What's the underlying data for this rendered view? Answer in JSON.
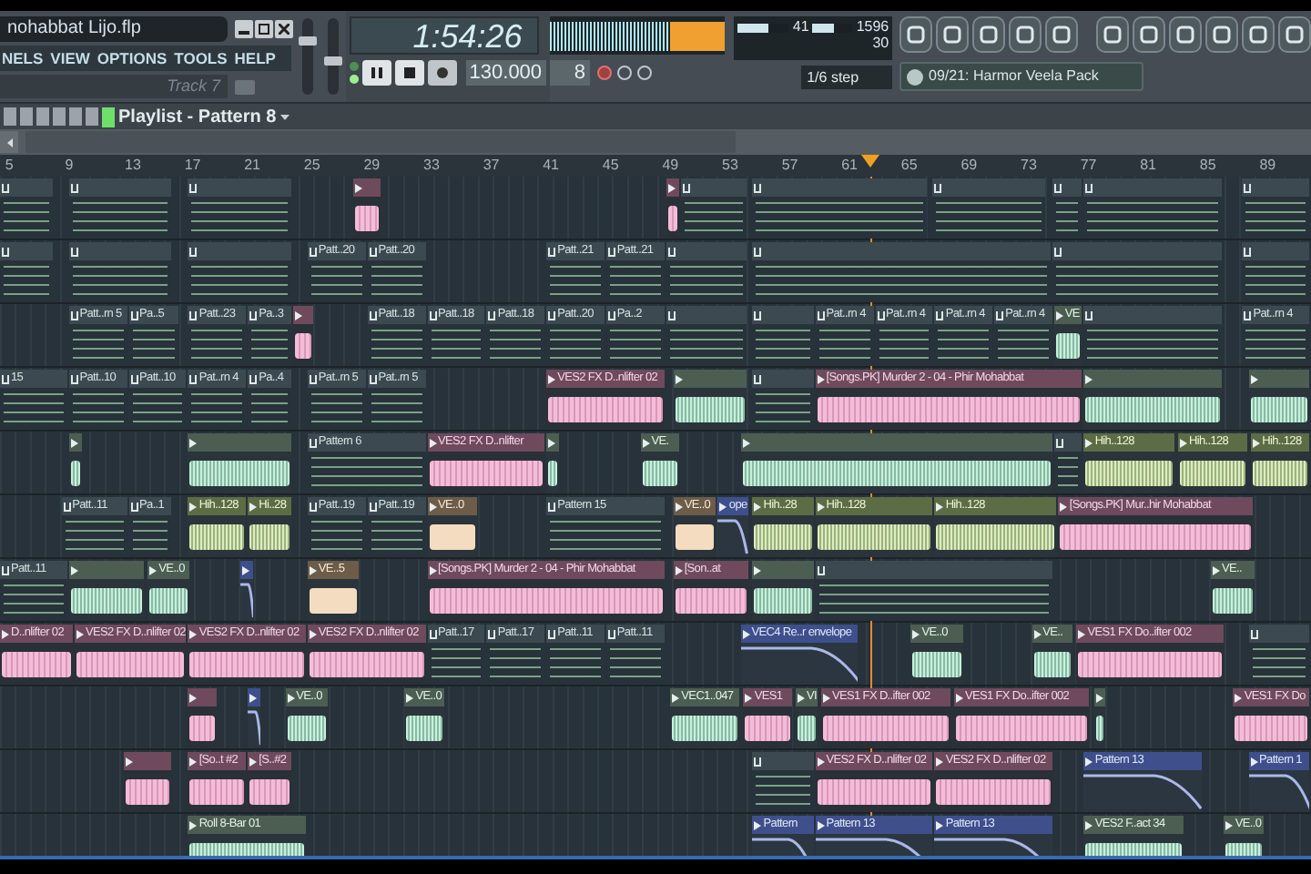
{
  "project": {
    "title": "nohabbat Lijo.flp"
  },
  "menu": [
    "NELS",
    "VIEW",
    "OPTIONS",
    "TOOLS",
    "HELP"
  ],
  "hint": "Track 7",
  "volume": {
    "level": 0.75
  },
  "pitch": {
    "level": 0.45
  },
  "time": "1:54:26",
  "tempo": "130.000",
  "pattern": "8",
  "cpu": {
    "value": "41",
    "level": 0.6
  },
  "memory": {
    "value": "1596",
    "level": 0.55
  },
  "polyphony": "30",
  "snap": "1/6 step",
  "browser": "09/21: Harmor Veela Pack",
  "playlist": {
    "title": "Playlist - Pattern 8"
  },
  "ruler": [
    "5",
    "9",
    "13",
    "17",
    "21",
    "25",
    "29",
    "33",
    "37",
    "41",
    "45",
    "49",
    "53",
    "57",
    "61",
    "65",
    "69",
    "73",
    "77",
    "81",
    "85",
    "89"
  ],
  "tracks": [
    {
      "clips": [
        {
          "kind": "pattern"
        },
        {
          "kind": "pattern"
        },
        {
          "kind": "pattern"
        },
        {
          "kind": "pink"
        },
        {
          "kind": "pink"
        },
        {
          "kind": "pattern"
        },
        {
          "kind": "pattern"
        },
        {
          "kind": "pattern"
        },
        {
          "kind": "pattern"
        },
        {
          "kind": "pattern"
        },
        {
          "kind": "pattern"
        }
      ]
    },
    {
      "clips": [
        {
          "kind": "pattern"
        },
        {
          "kind": "pattern"
        },
        {
          "kind": "pattern"
        },
        {
          "kind": "pattern",
          "label": "Patt..20"
        },
        {
          "kind": "pattern",
          "label": "Patt..20"
        },
        {
          "kind": "pattern",
          "label": "Patt..21"
        },
        {
          "kind": "pattern",
          "label": "Patt..21"
        },
        {
          "kind": "pattern"
        },
        {
          "kind": "pattern"
        },
        {
          "kind": "pattern"
        },
        {
          "kind": "pattern"
        }
      ]
    },
    {
      "clips": [
        {
          "kind": "pattern",
          "label": "Patt..rn 5"
        },
        {
          "kind": "pattern",
          "label": "Pa..5"
        },
        {
          "kind": "pattern",
          "label": "Patt..23"
        },
        {
          "kind": "pattern",
          "label": "Pa..3"
        },
        {
          "kind": "pink"
        },
        {
          "kind": "pattern",
          "label": "Patt..18"
        },
        {
          "kind": "pattern",
          "label": "Patt..18"
        },
        {
          "kind": "pattern",
          "label": "Patt..18"
        },
        {
          "kind": "pattern",
          "label": "Patt..20"
        },
        {
          "kind": "pattern",
          "label": "Pa..2"
        },
        {
          "kind": "pattern"
        },
        {
          "kind": "pattern"
        },
        {
          "kind": "pattern",
          "label": "Pat..rn 4"
        },
        {
          "kind": "pattern",
          "label": "Pat..rn 4"
        },
        {
          "kind": "pattern",
          "label": "Pat..rn 4"
        },
        {
          "kind": "pattern",
          "label": "Pat..rn 4"
        },
        {
          "kind": "mint",
          "label": "VE"
        },
        {
          "kind": "pattern"
        },
        {
          "kind": "pattern",
          "label": "Pat..rn 4"
        }
      ]
    },
    {
      "clips": [
        {
          "kind": "pattern",
          "label": "15"
        },
        {
          "kind": "pattern",
          "label": "Patt..10"
        },
        {
          "kind": "pattern",
          "label": "Patt..10"
        },
        {
          "kind": "pattern",
          "label": "Pat..rn 4"
        },
        {
          "kind": "pattern",
          "label": "Pa..4"
        },
        {
          "kind": "pattern",
          "label": "Pat..rn 5"
        },
        {
          "kind": "pattern",
          "label": "Pat..rn 5"
        },
        {
          "kind": "pink",
          "label": "VES2 FX D..nlifter 02"
        },
        {
          "kind": "mint"
        },
        {
          "kind": "pattern"
        },
        {
          "kind": "pink",
          "label": "[Songs.PK] Murder 2 - 04 - Phir Mohabbat"
        },
        {
          "kind": "mint"
        },
        {
          "kind": "mint"
        }
      ]
    },
    {
      "clips": [
        {
          "kind": "mint"
        },
        {
          "kind": "mint"
        },
        {
          "kind": "pattern",
          "label": "Pattern 6"
        },
        {
          "kind": "pink",
          "label": "VES2 FX D..nlifter"
        },
        {
          "kind": "mint"
        },
        {
          "kind": "mint",
          "label": "VE."
        },
        {
          "kind": "mint"
        },
        {
          "kind": "pattern"
        },
        {
          "kind": "lime",
          "label": "Hih..128"
        },
        {
          "kind": "lime",
          "label": "Hih..128"
        },
        {
          "kind": "lime",
          "label": "Hih..128"
        }
      ]
    },
    {
      "clips": [
        {
          "kind": "pattern",
          "label": "Patt..11"
        },
        {
          "kind": "pattern",
          "label": "Pa..1"
        },
        {
          "kind": "lime",
          "label": "Hih..128"
        },
        {
          "kind": "lime",
          "label": "Hi..28"
        },
        {
          "kind": "pattern",
          "label": "Patt..19"
        },
        {
          "kind": "pattern",
          "label": "Patt..19"
        },
        {
          "kind": "peach",
          "label": "VE..0"
        },
        {
          "kind": "pattern",
          "label": "Pattern 15"
        },
        {
          "kind": "peach",
          "label": "VE..0"
        },
        {
          "kind": "automation",
          "label": "ope"
        },
        {
          "kind": "lime",
          "label": "Hih..28"
        },
        {
          "kind": "lime",
          "label": "Hih..128"
        },
        {
          "kind": "lime",
          "label": "Hih..128"
        },
        {
          "kind": "pink",
          "label": "[Songs.PK] Mur..hir Mohabbat"
        }
      ]
    },
    {
      "clips": [
        {
          "kind": "pattern",
          "label": "Patt..11"
        },
        {
          "kind": "mint"
        },
        {
          "kind": "mint",
          "label": "VE..0"
        },
        {
          "kind": "automation"
        },
        {
          "kind": "peach",
          "label": "VE..5"
        },
        {
          "kind": "pink",
          "label": "[Songs.PK] Murder 2 - 04 - Phir Mohabbat"
        },
        {
          "kind": "pink",
          "label": "[Son..at"
        },
        {
          "kind": "mint"
        },
        {
          "kind": "pattern"
        },
        {
          "kind": "mint",
          "label": "VE.."
        }
      ]
    },
    {
      "clips": [
        {
          "kind": "pink",
          "label": "D..nlifter 02"
        },
        {
          "kind": "pink",
          "label": "VES2 FX D..nlifter 02"
        },
        {
          "kind": "pink",
          "label": "VES2 FX D..nlifter 02"
        },
        {
          "kind": "pink",
          "label": "VES2 FX D..nlifter 02"
        },
        {
          "kind": "pattern",
          "label": "Patt..17"
        },
        {
          "kind": "pattern",
          "label": "Patt..17"
        },
        {
          "kind": "pattern",
          "label": "Patt..11"
        },
        {
          "kind": "pattern",
          "label": "Patt..11"
        },
        {
          "kind": "automation",
          "label": "VEC4 Re..r envelope"
        },
        {
          "kind": "mint",
          "label": "VE..0"
        },
        {
          "kind": "mint",
          "label": "VE.."
        },
        {
          "kind": "pink",
          "label": "VES1 FX Do..ifter 002"
        },
        {
          "kind": "pattern"
        }
      ]
    },
    {
      "clips": [
        {
          "kind": "pink"
        },
        {
          "kind": "automation"
        },
        {
          "kind": "mint",
          "label": "VE..0"
        },
        {
          "kind": "mint",
          "label": "VE..0"
        },
        {
          "kind": "mint",
          "label": "VEC1..047"
        },
        {
          "kind": "pink",
          "label": "VES1"
        },
        {
          "kind": "mint",
          "label": "VI"
        },
        {
          "kind": "pink",
          "label": "VES1 FX D..ifter 002"
        },
        {
          "kind": "pink",
          "label": "VES1 FX Do..ifter 002"
        },
        {
          "kind": "mint"
        },
        {
          "kind": "pink",
          "label": "VES1 FX Do"
        }
      ]
    },
    {
      "clips": [
        {
          "kind": "pink"
        },
        {
          "kind": "pink",
          "label": "[So..t #2"
        },
        {
          "kind": "pink",
          "label": "[S..#2"
        },
        {
          "kind": "pattern"
        },
        {
          "kind": "pink",
          "label": "VES2 FX D..nlifter 02"
        },
        {
          "kind": "pink",
          "label": "VES2 FX D..nlifter 02"
        },
        {
          "kind": "automation",
          "label": "Pattern 13"
        },
        {
          "kind": "automation",
          "label": "Pattern 1"
        }
      ]
    },
    {
      "clips": [
        {
          "kind": "mint",
          "label": "Roll 8-Bar 01"
        },
        {
          "kind": "automation",
          "label": "Pattern"
        },
        {
          "kind": "automation",
          "label": "Pattern 13"
        },
        {
          "kind": "automation",
          "label": "Pattern 13"
        },
        {
          "kind": "mint",
          "label": "VES2 F..act 34"
        },
        {
          "kind": "mint",
          "label": "VE..0"
        }
      ]
    }
  ]
}
